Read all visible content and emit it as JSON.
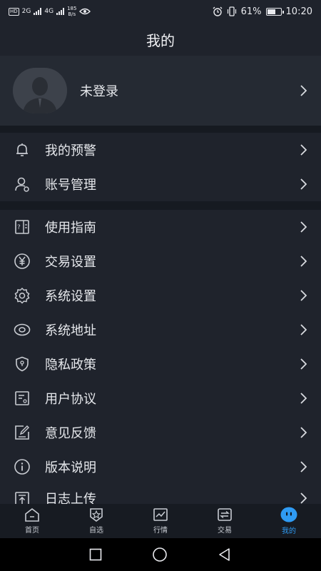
{
  "status_bar": {
    "left_badge": "HD",
    "net_gen": "2G",
    "net_gen2": "4G",
    "speed_value": "185",
    "speed_unit": "B/s",
    "battery_percent": "61%",
    "time": "10:20"
  },
  "header": {
    "title": "我的"
  },
  "profile": {
    "name": "未登录"
  },
  "menu": {
    "items": [
      {
        "label": "我的预警",
        "icon": "bell-icon"
      },
      {
        "label": "账号管理",
        "icon": "user-manage-icon"
      },
      {
        "label": "使用指南",
        "icon": "guide-icon"
      },
      {
        "label": "交易设置",
        "icon": "yen-icon"
      },
      {
        "label": "系统设置",
        "icon": "gear-icon"
      },
      {
        "label": "系统地址",
        "icon": "eye-icon"
      },
      {
        "label": "隐私政策",
        "icon": "shield-icon"
      },
      {
        "label": "用户协议",
        "icon": "agreement-icon"
      },
      {
        "label": "意见反馈",
        "icon": "edit-icon"
      },
      {
        "label": "版本说明",
        "icon": "info-icon"
      },
      {
        "label": "日志上传",
        "icon": "upload-icon"
      }
    ]
  },
  "tabbar": {
    "tabs": [
      {
        "label": "首页",
        "icon": "home-icon"
      },
      {
        "label": "自选",
        "icon": "star-shield-icon"
      },
      {
        "label": "行情",
        "icon": "chart-line-icon"
      },
      {
        "label": "交易",
        "icon": "exchange-icon"
      },
      {
        "label": "我的",
        "icon": "smile-icon"
      }
    ],
    "active": "我的"
  },
  "colors": {
    "background": "#1f232c",
    "accent": "#2f9bf3",
    "band": "#161a21"
  }
}
